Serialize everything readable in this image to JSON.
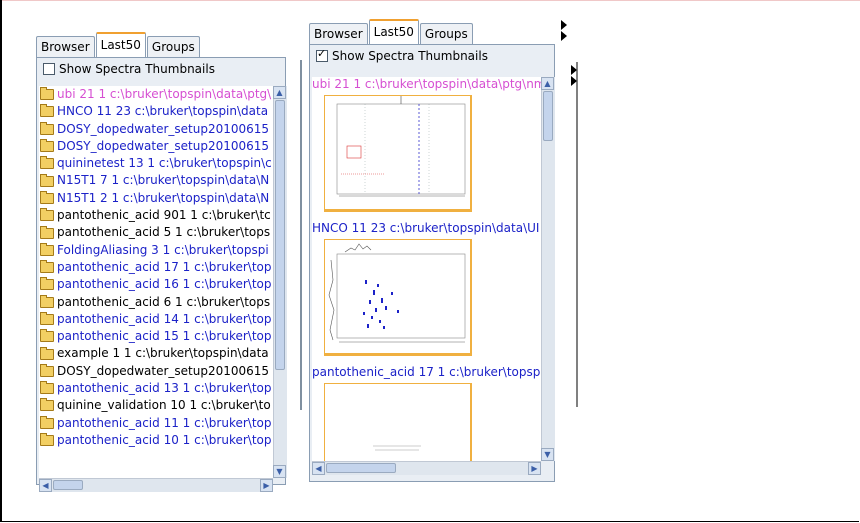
{
  "left_panel": {
    "tabs": [
      "Browser",
      "Last50",
      "Groups"
    ],
    "active_tab": "Last50",
    "show_thumbnails_label": "Show Spectra Thumbnails",
    "show_thumbnails_checked": false,
    "items": [
      {
        "text": "ubi  21  1  c:\\bruker\\topspin\\data\\ptg\\",
        "color": "#d64fd2"
      },
      {
        "text": "HNCO  11  23  c:\\bruker\\topspin\\data",
        "color": "#1c22c8"
      },
      {
        "text": "DOSY_dopedwater_setup20100615",
        "color": "#1c22c8"
      },
      {
        "text": "DOSY_dopedwater_setup20100615",
        "color": "#1c22c8"
      },
      {
        "text": "quininetest  13  1  c:\\bruker\\topspin\\c",
        "color": "#1c22c8"
      },
      {
        "text": "N15T1  7  1  c:\\bruker\\topspin\\data\\N",
        "color": "#1c22c8"
      },
      {
        "text": "N15T1  2  1  c:\\bruker\\topspin\\data\\N",
        "color": "#1c22c8"
      },
      {
        "text": "pantothenic_acid  901  1  c:\\bruker\\tc",
        "color": "#000000"
      },
      {
        "text": "pantothenic_acid  5  1  c:\\bruker\\tops",
        "color": "#000000"
      },
      {
        "text": "FoldingAliasing  3  1  c:\\bruker\\topspi",
        "color": "#1c22c8"
      },
      {
        "text": "pantothenic_acid  17  1  c:\\bruker\\top",
        "color": "#1c22c8"
      },
      {
        "text": "pantothenic_acid  16  1  c:\\bruker\\top",
        "color": "#1c22c8"
      },
      {
        "text": "pantothenic_acid  6  1  c:\\bruker\\tops",
        "color": "#000000"
      },
      {
        "text": "pantothenic_acid  14  1  c:\\bruker\\top",
        "color": "#1c22c8"
      },
      {
        "text": "pantothenic_acid  15  1  c:\\bruker\\top",
        "color": "#1c22c8"
      },
      {
        "text": "example  1  1  c:\\bruker\\topspin\\data",
        "color": "#000000"
      },
      {
        "text": "DOSY_dopedwater_setup20100615",
        "color": "#000000"
      },
      {
        "text": "pantothenic_acid  13  1  c:\\bruker\\top",
        "color": "#1c22c8"
      },
      {
        "text": "quinine_validation  10  1  c:\\bruker\\to",
        "color": "#000000"
      },
      {
        "text": "pantothenic_acid  11  1  c:\\bruker\\top",
        "color": "#1c22c8"
      },
      {
        "text": "pantothenic_acid  10  1  c:\\bruker\\top",
        "color": "#1c22c8"
      }
    ]
  },
  "right_panel": {
    "tabs": [
      "Browser",
      "Last50",
      "Groups"
    ],
    "active_tab": "Last50",
    "show_thumbnails_label": "Show Spectra Thumbnails",
    "show_thumbnails_checked": true,
    "spectra": [
      {
        "title": "ubi  21  1  c:\\bruker\\topspin\\data\\ptg\\nm",
        "color": "#d64fd2"
      },
      {
        "title": "HNCO  11  23  c:\\bruker\\topspin\\data\\UI",
        "color": "#1c22c8"
      },
      {
        "title": "pantothenic_acid  17  1  c:\\bruker\\topsp",
        "color": "#1c22c8"
      }
    ]
  },
  "colors": {
    "pink": "#d64fd2",
    "blue": "#1c22c8",
    "black": "#000000",
    "tab_accent": "#f0a030"
  },
  "icons": {
    "folder": "folder-icon",
    "scroll_up": "arrow-up-icon",
    "scroll_down": "arrow-down-icon",
    "scroll_left": "arrow-left-icon",
    "scroll_right": "arrow-right-icon"
  }
}
